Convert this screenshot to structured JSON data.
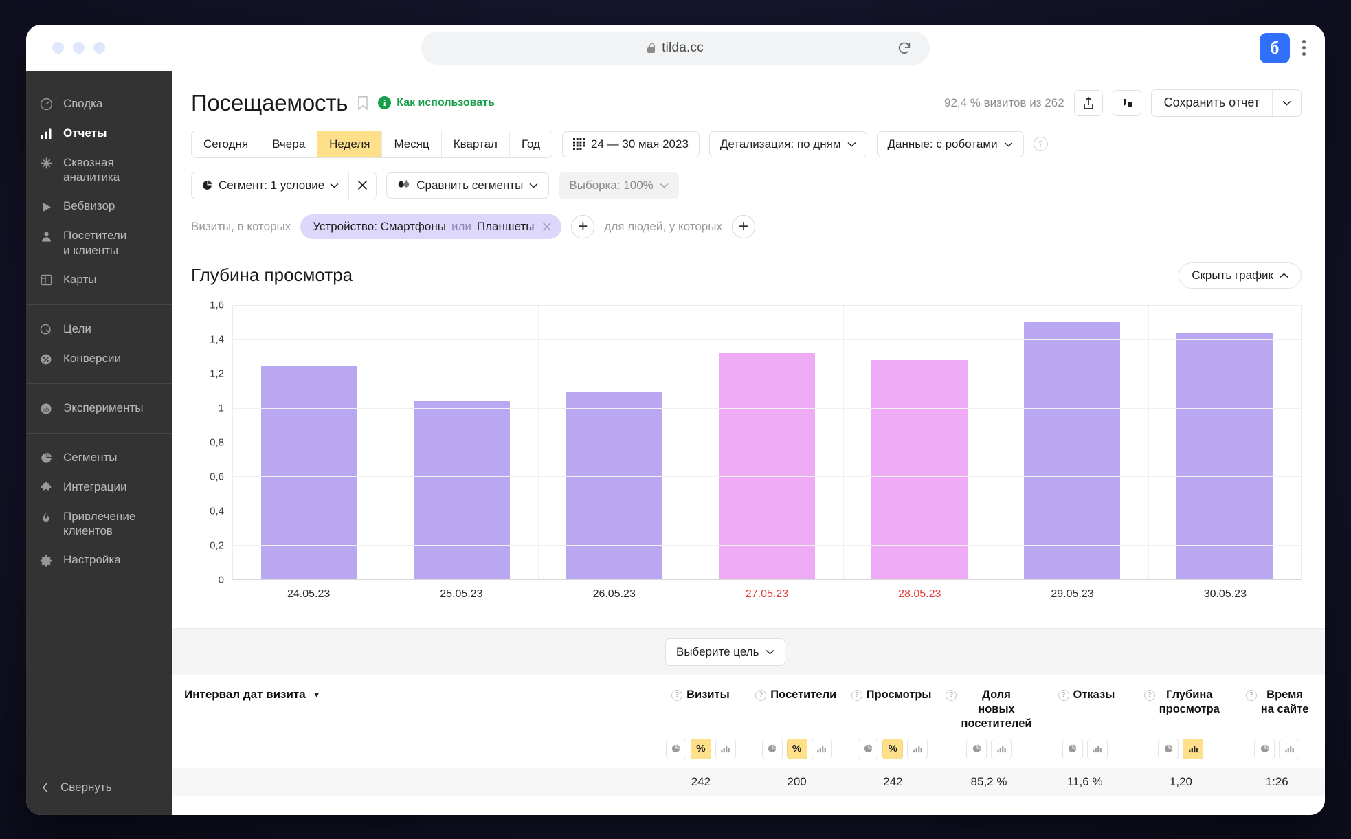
{
  "browser": {
    "url": "tilda.cc",
    "lock_icon": "lock-icon",
    "reload_icon": "reload-icon",
    "brand_letter": "᲼",
    "menu_icon": "kebab-menu-icon"
  },
  "sidebar": {
    "groups": [
      {
        "items": [
          {
            "label": "Сводка",
            "icon": "gauge-icon",
            "active": false
          },
          {
            "label": "Отчеты",
            "icon": "bar-chart-icon",
            "active": true
          },
          {
            "label": "Сквозная\nаналитика",
            "icon": "snowflake-icon",
            "active": false
          },
          {
            "label": "Вебвизор",
            "icon": "play-icon",
            "active": false
          },
          {
            "label": "Посетители\nи клиенты",
            "icon": "user-icon",
            "active": false
          },
          {
            "label": "Карты",
            "icon": "layout-icon",
            "active": false
          }
        ]
      },
      {
        "items": [
          {
            "label": "Цели",
            "icon": "target-cursor-icon",
            "active": false
          },
          {
            "label": "Конверсии",
            "icon": "percent-circle-icon",
            "active": false
          }
        ]
      },
      {
        "items": [
          {
            "label": "Эксперименты",
            "icon": "ab-test-icon",
            "active": false
          }
        ]
      },
      {
        "items": [
          {
            "label": "Сегменты",
            "icon": "pie-chart-icon",
            "active": false
          },
          {
            "label": "Интеграции",
            "icon": "puzzle-icon",
            "active": false
          },
          {
            "label": "Привлечение\nклиентов",
            "icon": "flame-icon",
            "active": false
          },
          {
            "label": "Настройка",
            "icon": "gear-icon",
            "active": false
          }
        ]
      }
    ],
    "collapse_label": "Свернуть",
    "collapse_icon": "chevron-left-icon"
  },
  "header": {
    "title": "Посещаемость",
    "bookmark_icon": "bookmark-icon",
    "how_to_use": "Как использовать",
    "info_icon": "info-icon",
    "visits_note": "92,4 % визитов из 262",
    "export_icon": "share-upload-icon",
    "compare_icon": "compare-icon",
    "save_report": "Сохранить отчет",
    "save_report_arrow_icon": "chevron-down-icon"
  },
  "toolbar": {
    "periods": [
      {
        "label": "Сегодня",
        "selected": false
      },
      {
        "label": "Вчера",
        "selected": false
      },
      {
        "label": "Неделя",
        "selected": true
      },
      {
        "label": "Месяц",
        "selected": false
      },
      {
        "label": "Квартал",
        "selected": false
      },
      {
        "label": "Год",
        "selected": false
      }
    ],
    "date_range": "24 — 30 мая 2023",
    "calendar_icon": "calendar-icon",
    "detail_level": "Детализация: по дням",
    "data_mode": "Данные: с роботами",
    "help_icon": "question-mark-icon"
  },
  "segments_bar": {
    "segment_label": "Сегмент: 1 условие",
    "segment_icon": "pie-slice-icon",
    "segment_clear_icon": "close-icon",
    "compare_segments": "Сравнить сегменты",
    "compare_icon": "two-drops-icon",
    "sampling": "Выборка: 100%"
  },
  "filter_row": {
    "prefix": "Визиты, в которых",
    "chip": {
      "prefix": "Устройство: Смартфоны",
      "conjunction": "или",
      "suffix": "Планшеты",
      "remove_icon": "close-icon"
    },
    "add_visit_condition_icon": "plus-icon",
    "middle": "для людей, у которых",
    "add_people_condition_icon": "plus-icon"
  },
  "chart_section": {
    "title": "Глубина просмотра",
    "hide_chart": "Скрыть график",
    "hide_chart_icon": "chevron-up-icon"
  },
  "chart_data": {
    "type": "bar",
    "title": "Глубина просмотра",
    "xlabel": "",
    "ylabel": "",
    "ylim": [
      0,
      1.6
    ],
    "yticks": [
      "0",
      "0,2",
      "0,4",
      "0,6",
      "0,8",
      "1",
      "1,2",
      "1,4",
      "1,6"
    ],
    "ytick_values": [
      0,
      0.2,
      0.4,
      0.6,
      0.8,
      1.0,
      1.2,
      1.4,
      1.6
    ],
    "grid": true,
    "legend": "none",
    "categories": [
      "24.05.23",
      "25.05.23",
      "26.05.23",
      "27.05.23",
      "28.05.23",
      "29.05.23",
      "30.05.23"
    ],
    "weekend_categories": [
      "27.05.23",
      "28.05.23"
    ],
    "values": [
      1.25,
      1.04,
      1.09,
      1.32,
      1.28,
      1.5,
      1.44
    ],
    "bar_colors": [
      "#b9a7f2",
      "#b9a7f2",
      "#b9a7f2",
      "#eeaaf5",
      "#eeaaf5",
      "#b9a7f2",
      "#b9a7f2"
    ],
    "accent_violet": "#b9a7f2",
    "accent_pink": "#eeaaf5",
    "weekend_label_color": "#e23b3b"
  },
  "table": {
    "goal_select": "Выберите цель",
    "goal_select_icon": "chevron-down-icon",
    "first_column": "Интервал дат визита",
    "sort_icon": "sort-desc-icon",
    "columns": [
      {
        "label": "Визиты",
        "modes": [
          "pie",
          "percent",
          "bars"
        ],
        "active": "percent"
      },
      {
        "label": "Посетители",
        "modes": [
          "pie",
          "percent",
          "bars"
        ],
        "active": "percent"
      },
      {
        "label": "Просмотры",
        "modes": [
          "pie",
          "percent",
          "bars"
        ],
        "active": "percent"
      },
      {
        "label": "Доля\nновых\nпосетителей",
        "modes": [
          "pie",
          "bars"
        ],
        "active": ""
      },
      {
        "label": "Отказы",
        "modes": [
          "pie",
          "bars"
        ],
        "active": ""
      },
      {
        "label": "Глубина\nпросмотра",
        "modes": [
          "pie",
          "bars"
        ],
        "active": "bars"
      },
      {
        "label": "Время\nна сайте",
        "modes": [
          "pie",
          "bars"
        ],
        "active": ""
      }
    ],
    "rows": [
      {
        "label": "",
        "values": [
          "242",
          "200",
          "242",
          "85,2 %",
          "11,6 %",
          "1,20",
          "1:26"
        ]
      }
    ]
  }
}
